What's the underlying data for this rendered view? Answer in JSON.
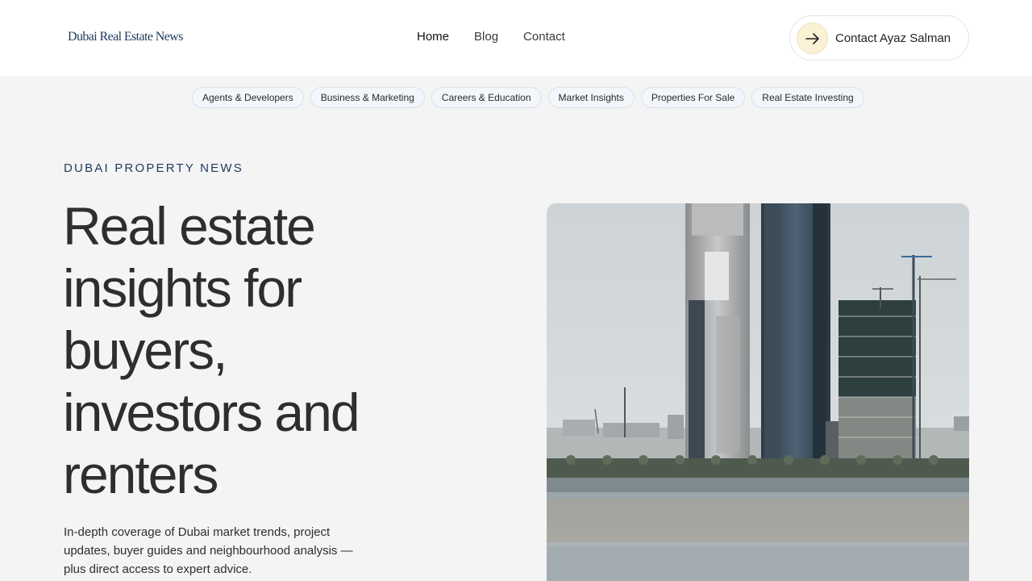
{
  "header": {
    "logo_text": "Dubai Real Estate News",
    "nav": [
      {
        "label": "Home"
      },
      {
        "label": "Blog"
      },
      {
        "label": "Contact"
      }
    ],
    "contact_button_label": "Contact Ayaz Salman",
    "contact_icon": "arrow-right-icon"
  },
  "categories": [
    "Agents & Developers",
    "Business & Marketing",
    "Careers & Education",
    "Market Insights",
    "Properties For Sale",
    "Real Estate Investing"
  ],
  "hero": {
    "eyebrow": "DUBAI PROPERTY NEWS",
    "headline": "Real estate insights for buyers, investors and renters",
    "intro": "In-depth coverage of Dubai market trends, project updates, buyer guides and neighbourhood analysis — plus direct access to expert advice."
  },
  "colors": {
    "brand": "#1f3a5f",
    "page_background": "#f4f4f4",
    "accent_circle": "#fbf1d4"
  }
}
